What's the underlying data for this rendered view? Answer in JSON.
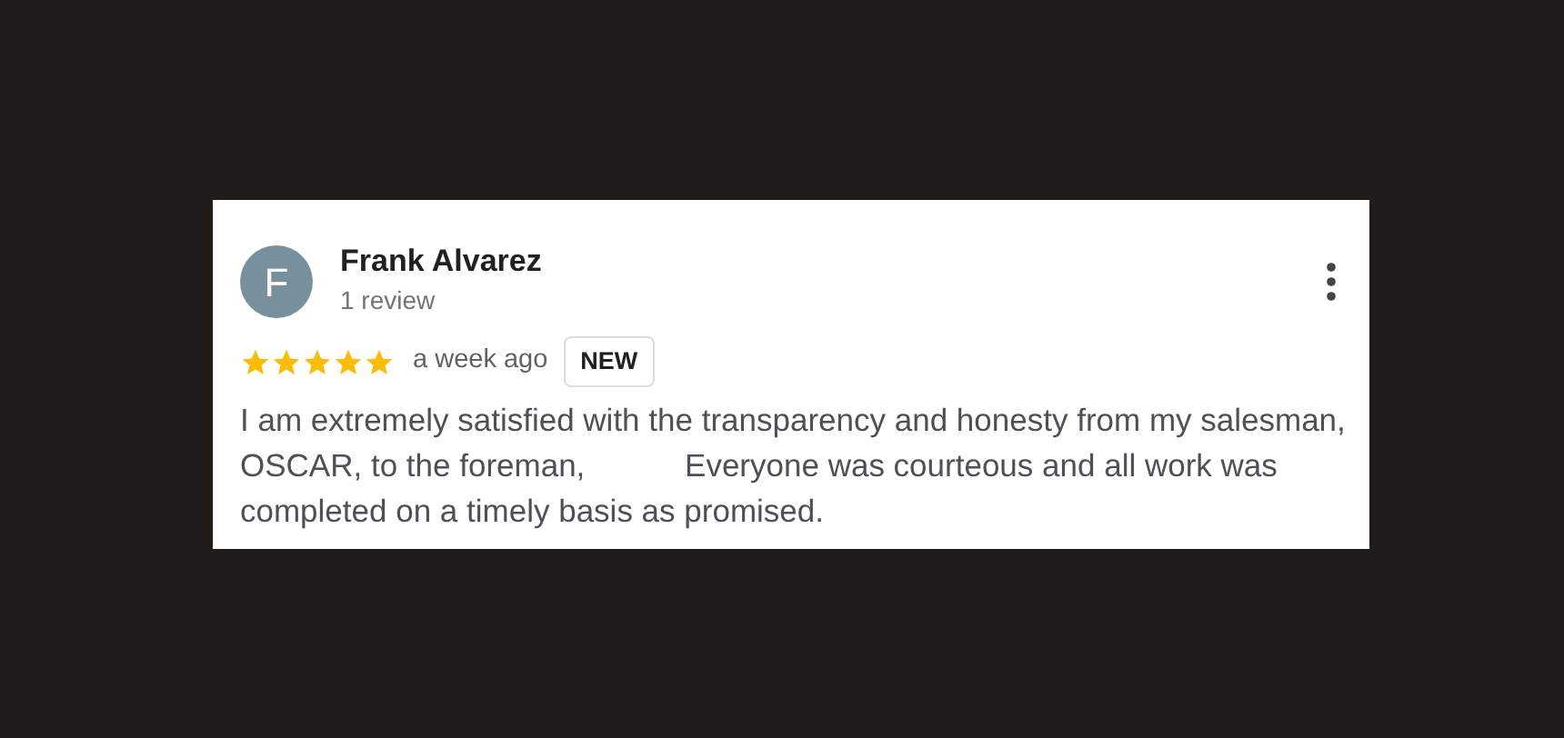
{
  "review": {
    "avatar_initial": "F",
    "author": "Frank Alvarez",
    "review_count": "1 review",
    "stars": 5,
    "time": "a week ago",
    "badge": "NEW",
    "text_segments": [
      "I am extremely satisfied with the transparency and honesty from my salesman, OSCAR, to the foreman,",
      "Everyone was courteous and all work was completed on a timely basis as promised."
    ]
  }
}
